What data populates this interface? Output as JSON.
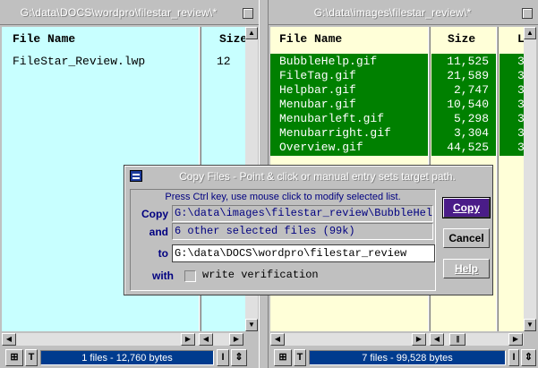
{
  "left_pane": {
    "title": "G:\\data\\DOCS\\wordpro\\filestar_review\\*",
    "columns": {
      "name": "File Name",
      "size": "Size"
    },
    "files": [
      {
        "name": "FileStar_Review.lwp",
        "size": "12"
      }
    ],
    "status": "1 files - 12,760 bytes",
    "btn_t": "T",
    "btn_i": "I"
  },
  "right_pane": {
    "title": "G:\\data\\images\\filestar_review\\*",
    "columns": {
      "name": "File Name",
      "size": "Size",
      "lw": "LW"
    },
    "files": [
      {
        "name": "BubbleHelp.gif",
        "size": "11,525",
        "lw": "3"
      },
      {
        "name": "FileTag.gif",
        "size": "21,589",
        "lw": "3"
      },
      {
        "name": "Helpbar.gif",
        "size": "2,747",
        "lw": "3"
      },
      {
        "name": "Menubar.gif",
        "size": "10,540",
        "lw": "3"
      },
      {
        "name": "Menubarleft.gif",
        "size": "5,298",
        "lw": "3"
      },
      {
        "name": "Menubarright.gif",
        "size": "3,304",
        "lw": "3"
      },
      {
        "name": "Overview.gif",
        "size": "44,525",
        "lw": "3"
      }
    ],
    "status": "7 files - 99,528 bytes",
    "btn_t": "T",
    "btn_i": "I"
  },
  "dialog": {
    "title": "Copy Files - Point & click or manual entry sets target path.",
    "hint": "Press Ctrl key, use mouse click to modify selected list.",
    "copy_label": "Copy",
    "copy_value": "G:\\data\\images\\filestar_review\\BubbleHelp.g",
    "and_label": "and",
    "and_value": "6  other selected files (99k)",
    "to_label": "to",
    "to_value": "G:\\data\\DOCS\\wordpro\\filestar_review",
    "with_label": "with",
    "verify_label": "write verification",
    "verify_checked": false,
    "buttons": {
      "copy": "Copy",
      "cancel": "Cancel",
      "help": "Help"
    }
  },
  "colors": {
    "left_bg": "#c8ffff",
    "right_bg": "#ffffd8",
    "selection": "#008000",
    "status_bg": "#003b8e",
    "default_button": "#4a1c88"
  }
}
